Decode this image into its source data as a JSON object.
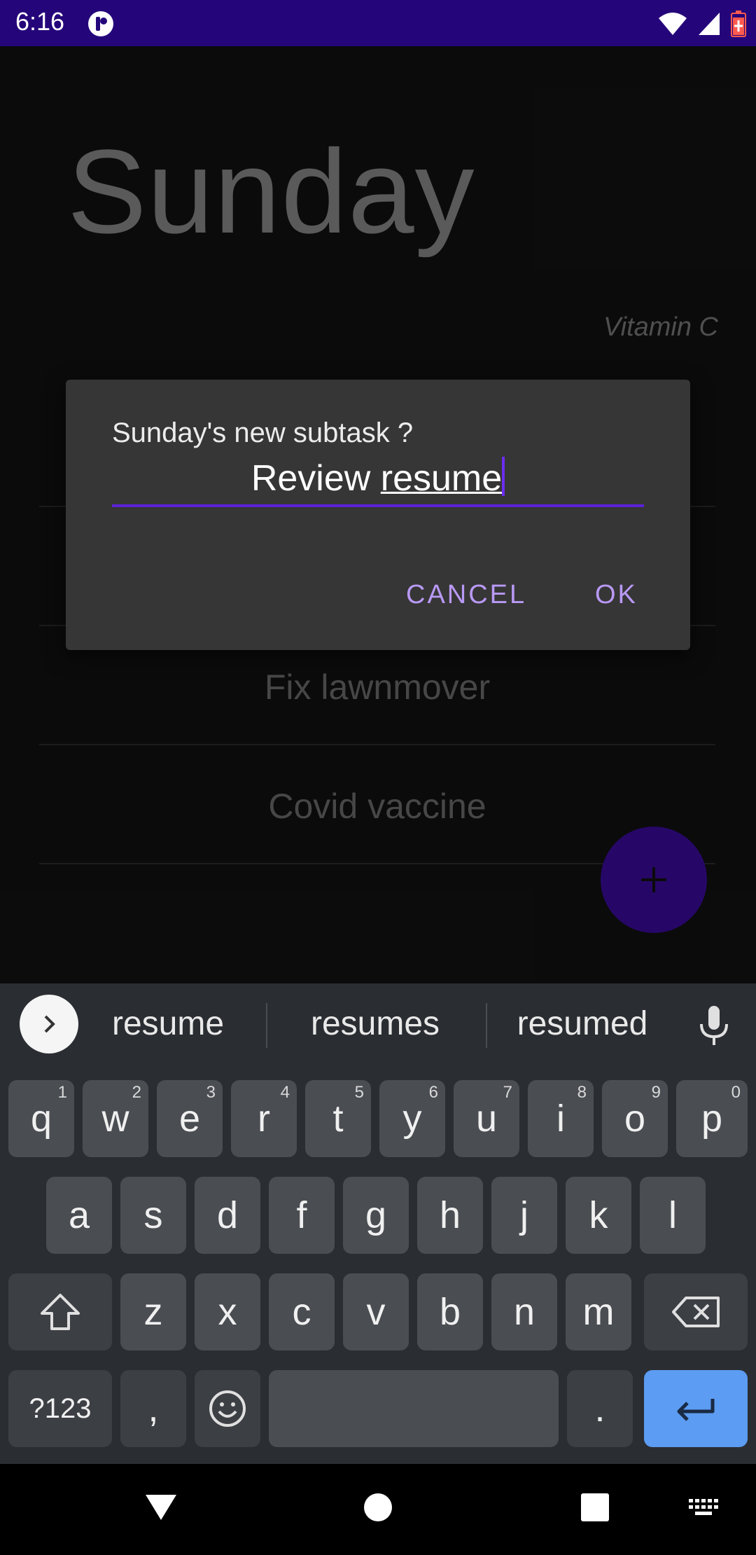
{
  "status_bar": {
    "time": "6:16"
  },
  "app": {
    "day_title": "Sunday",
    "subtitle": "Vitamin C",
    "tasks": [
      "Fix lawnmover",
      "Covid vaccine"
    ],
    "fab_label": "+"
  },
  "dialog": {
    "title": "Sunday's new subtask ?",
    "input_prefix": "Review ",
    "input_typed": "resume",
    "cancel_label": "CANCEL",
    "ok_label": "OK",
    "accent_color": "#5b21d6"
  },
  "keyboard": {
    "suggestions": [
      "resume",
      "resumes",
      "resumed"
    ],
    "row1": [
      {
        "k": "q",
        "h": "1"
      },
      {
        "k": "w",
        "h": "2"
      },
      {
        "k": "e",
        "h": "3"
      },
      {
        "k": "r",
        "h": "4"
      },
      {
        "k": "t",
        "h": "5"
      },
      {
        "k": "y",
        "h": "6"
      },
      {
        "k": "u",
        "h": "7"
      },
      {
        "k": "i",
        "h": "8"
      },
      {
        "k": "o",
        "h": "9"
      },
      {
        "k": "p",
        "h": "0"
      }
    ],
    "row2": [
      "a",
      "s",
      "d",
      "f",
      "g",
      "h",
      "j",
      "k",
      "l"
    ],
    "row3": [
      "z",
      "x",
      "c",
      "v",
      "b",
      "n",
      "m"
    ],
    "symbols_label": "?123",
    "comma_label": ",",
    "period_label": "."
  }
}
